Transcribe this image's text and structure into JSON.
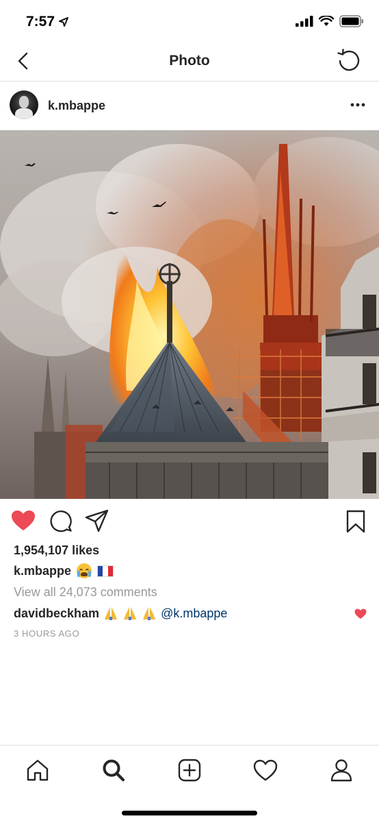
{
  "status": {
    "time": "7:57"
  },
  "header": {
    "title": "Photo"
  },
  "post": {
    "username": "k.mbappe",
    "likes": "1,954,107 likes",
    "caption_user": "k.mbappe",
    "view_all_comments": "View all 24,073 comments",
    "comment": {
      "user": "davidbeckham",
      "mention": "@k.mbappe"
    },
    "time_ago": "3 HOURS AGO"
  },
  "colors": {
    "like_red": "#ed4956",
    "text": "#262626",
    "muted": "#999999",
    "mention": "#003569"
  },
  "icons": {
    "back": "chevron-left-icon",
    "refresh": "refresh-icon",
    "more": "more-dots-icon",
    "like": "heart-filled-icon",
    "comment": "comment-icon",
    "share": "paper-plane-icon",
    "save": "bookmark-icon",
    "home": "home-icon",
    "search": "search-icon",
    "add": "add-post-icon",
    "activity": "heart-outline-icon",
    "profile": "profile-icon"
  }
}
